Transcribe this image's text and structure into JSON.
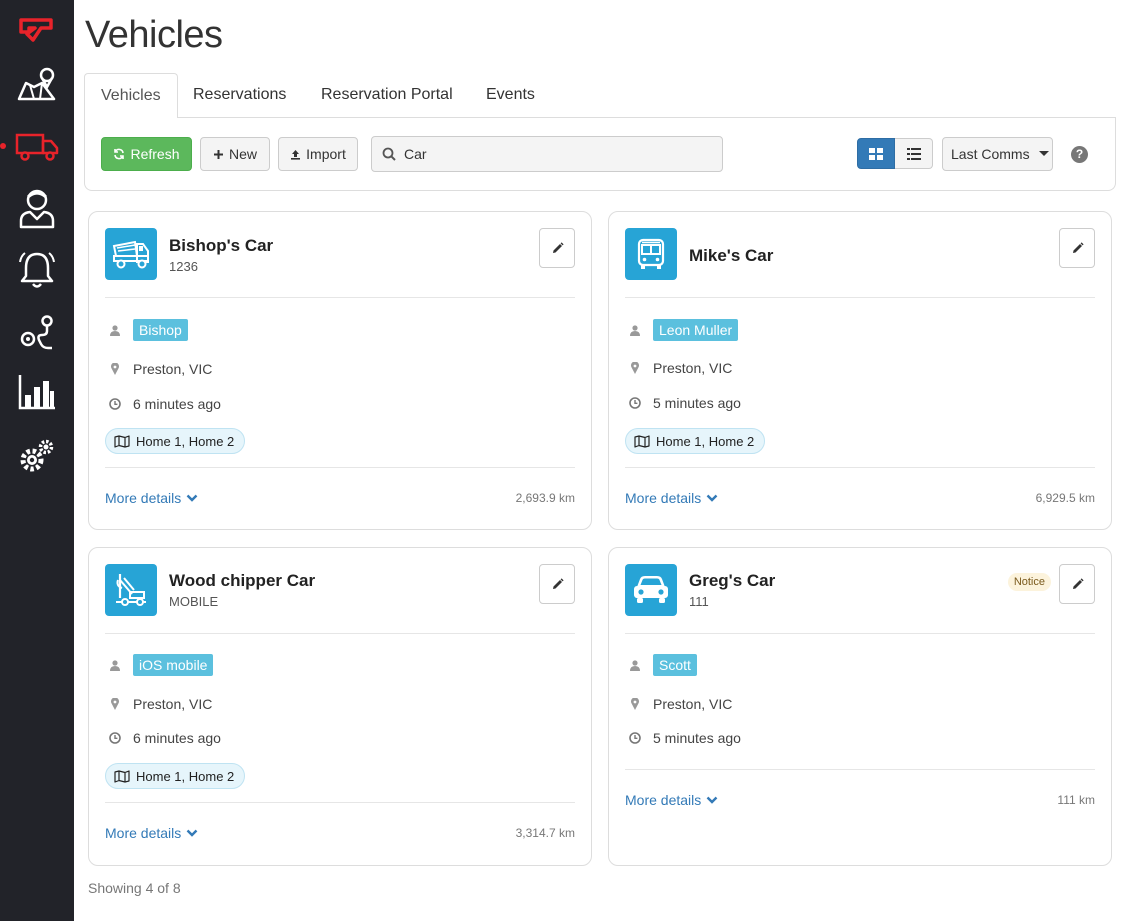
{
  "sidebar": {
    "items": [
      {
        "icon": "logo-icon"
      },
      {
        "icon": "map-icon"
      },
      {
        "icon": "truck-icon",
        "active": true
      },
      {
        "icon": "user-icon"
      },
      {
        "icon": "bell-icon"
      },
      {
        "icon": "route-icon"
      },
      {
        "icon": "chart-icon"
      },
      {
        "icon": "gears-icon"
      }
    ],
    "accent_color": "#e8232a"
  },
  "page": {
    "title": "Vehicles"
  },
  "tabs": [
    {
      "label": "Vehicles",
      "active": true
    },
    {
      "label": "Reservations"
    },
    {
      "label": "Reservation Portal"
    },
    {
      "label": "Events"
    }
  ],
  "toolbar": {
    "refresh_label": "Refresh",
    "new_label": "New",
    "import_label": "Import",
    "search_value": "Car",
    "sort_label": "Last Comms",
    "help_label": "?"
  },
  "vehicles": [
    {
      "name": "Bishop's Car",
      "sub": "1236",
      "icon": "dump-truck-icon",
      "driver": "Bishop",
      "location": "Preston, VIC",
      "last_seen": "6 minutes ago",
      "zones": "Home 1, Home 2",
      "more": "More details",
      "distance": "2,693.9 km"
    },
    {
      "name": "Mike's Car",
      "sub": "",
      "icon": "bus-icon",
      "driver": "Leon Muller",
      "location": "Preston, VIC",
      "last_seen": "5 minutes ago",
      "zones": "Home 1, Home 2",
      "more": "More details",
      "distance": "6,929.5 km"
    },
    {
      "name": "Wood chipper Car",
      "sub": "MOBILE",
      "icon": "forklift-icon",
      "driver": "iOS mobile",
      "location": "Preston, VIC",
      "last_seen": "6 minutes ago",
      "zones": "Home 1, Home 2",
      "more": "More details",
      "distance": "3,314.7 km"
    },
    {
      "name": "Greg's Car",
      "sub": "111",
      "icon": "car-icon",
      "badge": "Notice",
      "driver": "Scott",
      "location": "Preston, VIC",
      "last_seen": "5 minutes ago",
      "more": "More details",
      "distance": "111 km"
    }
  ],
  "footer": {
    "showing": "Showing 4 of 8"
  },
  "colors": {
    "primary": "#337ab7",
    "success": "#5cb85c",
    "info": "#5bc0de",
    "vehicle_icon_bg": "#27a4d6"
  }
}
